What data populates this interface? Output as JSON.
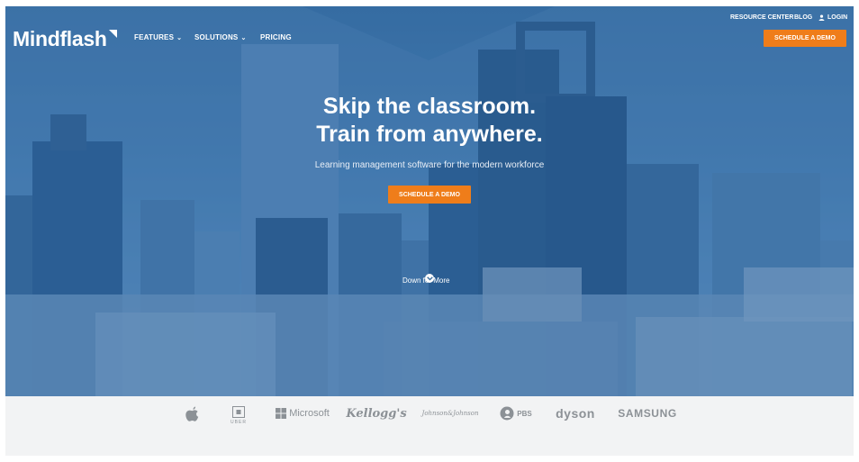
{
  "header": {
    "logo_text": "Mindflash",
    "nav": {
      "features": "FEATURES",
      "solutions": "SOLUTIONS",
      "pricing": "PRICING"
    },
    "utility": {
      "resource_center": "RESOURCE CENTER",
      "blog": "BLOG",
      "login": "LOGIN"
    },
    "cta": "SCHEDULE A DEMO"
  },
  "hero": {
    "headline_line1": "Skip the classroom.",
    "headline_line2": "Train from anywhere.",
    "subheadline": "Learning management software for the modern workforce",
    "cta": "SCHEDULE A DEMO",
    "down_text": "Down for More"
  },
  "clients": {
    "uber": "UBER",
    "microsoft": "Microsoft",
    "kelloggs": "Kellogg's",
    "jnj": "Johnson&Johnson",
    "pbs": "PBS",
    "dyson": "dyson",
    "samsung": "SAMSUNG"
  },
  "colors": {
    "accent": "#ef7d1a",
    "hero_overlay": "#3d6f9f",
    "logo_strip_bg": "#f2f3f4",
    "brand_gray": "#8c9196"
  }
}
